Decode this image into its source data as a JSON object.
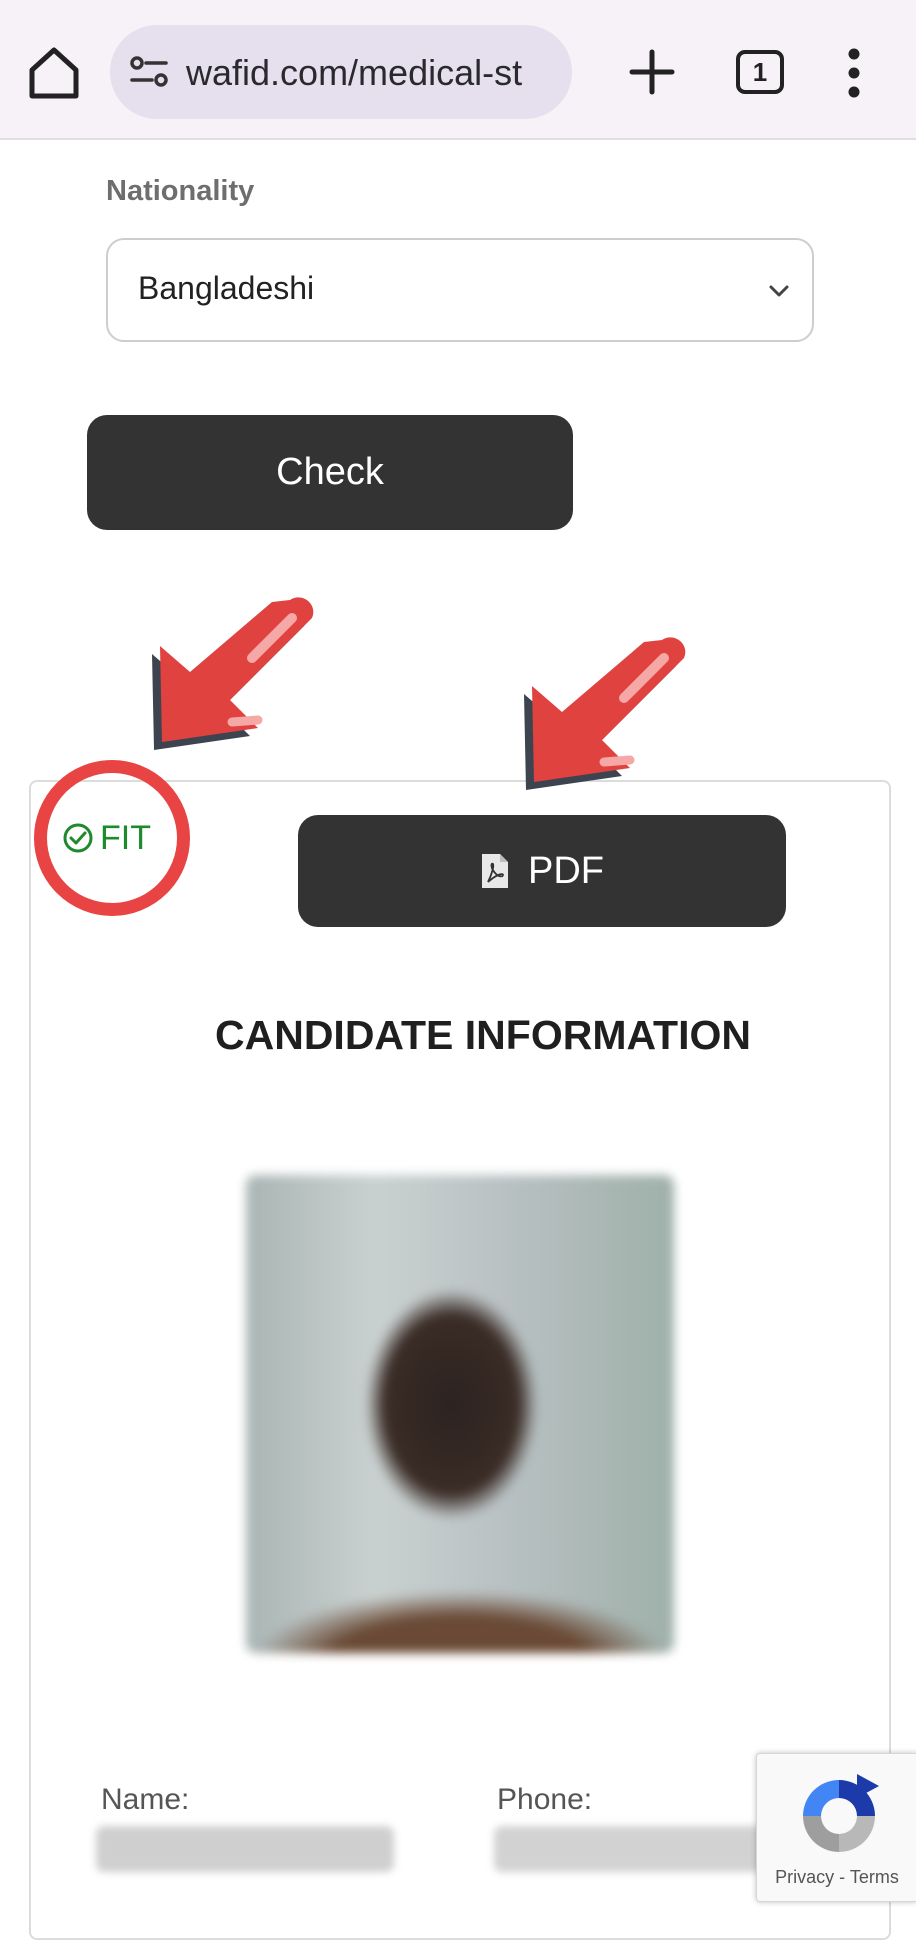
{
  "browser": {
    "url": "wafid.com/medical-st",
    "tab_count": "1"
  },
  "form": {
    "nationality_label": "Nationality",
    "nationality_value": "Bangladeshi",
    "check_label": "Check"
  },
  "result": {
    "status": "FIT",
    "pdf_label": "PDF",
    "section_title": "CANDIDATE INFORMATION",
    "name_label": "Name:",
    "phone_label": "Phone:"
  },
  "recaptcha": {
    "privacy": "Privacy",
    "separator": " - ",
    "terms": "Terms"
  },
  "colors": {
    "button_dark": "#333333",
    "fit_green": "#1d8a2c",
    "annotation_red": "#e74443"
  },
  "icons": [
    "home-icon",
    "site-info-icon",
    "plus-icon",
    "tabs-icon",
    "more-vert-icon",
    "chevron-down-icon",
    "check-circle-icon",
    "pdf-file-icon",
    "recaptcha-logo-icon",
    "arrow-annotation"
  ]
}
